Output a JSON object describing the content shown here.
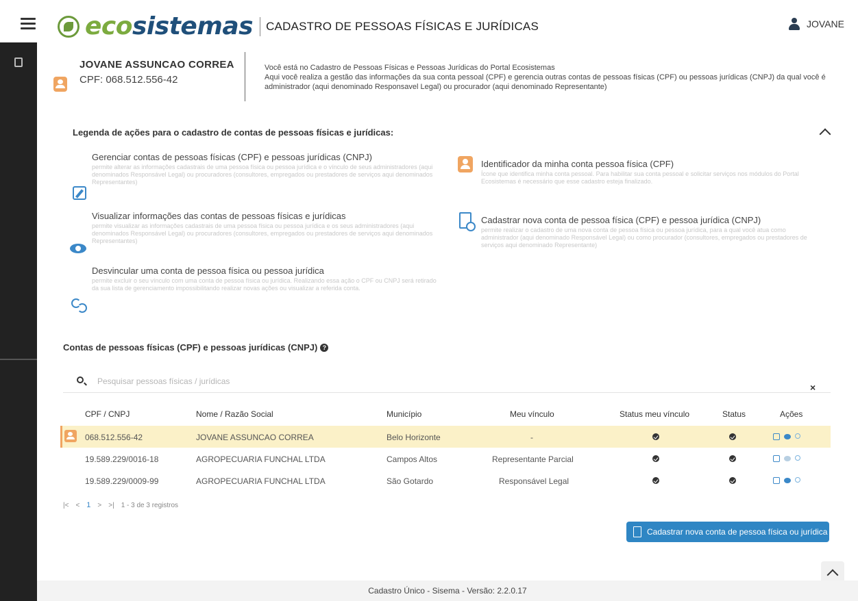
{
  "header": {
    "logo_eco": "eco",
    "logo_sis": "sistemas",
    "title": "CADASTRO DE PESSOAS FÍSICAS E JURÍDICAS",
    "user": "JOVANE"
  },
  "profile": {
    "name": "JOVANE ASSUNCAO CORREA",
    "cpf": "CPF: 068.512.556-42"
  },
  "intro": {
    "line1": "Você está no Cadastro de Pessoas Físicas e Pessoas Jurídicas do Portal Ecosistemas",
    "line2": "Aqui você realiza a gestão das informações da sua conta pessoal (CPF) e gerencia outras contas de pessoas físicas (CPF) ou pessoas jurídicas (CNPJ) da qual você é administrador (aqui denominado Responsavel Legal) ou procurador (aqui denominado Representante)"
  },
  "legend": {
    "title": "Legenda de ações para o cadastro de contas de pessoas físicas e jurídicas:",
    "items": [
      {
        "title": "Gerenciar contas de pessoas físicas (CPF) e pessoas jurídicas (CNPJ)",
        "desc": "permite alterar as informações cadastrais de uma pessoa física ou pessoa jurídica e o vínculo de seus administradores (aqui denominados Responsável Legal) ou procuradores (consultores, empregados ou prestadores de serviços aqui denominados Representantes)",
        "icon": "edit-icon"
      },
      {
        "title": "Visualizar informações das contas de pessoas físicas e jurídicas",
        "desc": "permite visualizar as informações cadastrais de uma pessoa física ou pessoa jurídica e os seus administradores (aqui denominados Responsável Legal) ou procuradores (consultores, empregados ou prestadores de serviços aqui denominados Representantes)",
        "icon": "eye-icon"
      },
      {
        "title": "Desvincular uma conta de pessoa física ou pessoa jurídica",
        "desc": "permite excluir o seu vínculo com uma conta de pessoa física ou jurídica. Realizando essa ação o CPF ou CNPJ será retirado da sua lista de gerenciamento impossibilitando realizar novas ações ou visualizar a referida conta.",
        "icon": "unlink-icon"
      },
      {
        "title": "Identificador da minha conta pessoa física (CPF)",
        "desc": "Ícone que identifica minha conta pessoal. Para habilitar sua conta pessoal e solicitar serviços nos módulos do Portal Ecosistemas é necessário que esse cadastro esteja finalizado.",
        "icon": "person-icon"
      },
      {
        "title": "Cadastrar nova conta de pessoa física (CPF) e pessoa jurídica (CNPJ)",
        "desc": "permite realizar o cadastro de uma nova conta de pessoa física ou pessoa jurídica, para a qual você atua como administrador (aqui denominado Responsável Legal) ou como procurador (consultores, empregados ou prestadores de serviços aqui denominado Representante)",
        "icon": "new-document-icon"
      }
    ]
  },
  "accounts": {
    "title": "Contas de pessoas físicas (CPF) e pessoas jurídicas (CNPJ)",
    "search_placeholder": "Pesquisar pessoas físicas / jurídicas",
    "columns": [
      "CPF / CNPJ",
      "Nome / Razão Social",
      "Município",
      "Meu vínculo",
      "Status meu vínculo",
      "Status",
      "Ações"
    ],
    "rows": [
      {
        "id": "068.512.556-42",
        "name": "JOVANE ASSUNCAO CORREA",
        "city": "Belo Horizonte",
        "link": "-",
        "highlight": true
      },
      {
        "id": "19.589.229/0016-18",
        "name": "AGROPECUARIA FUNCHAL LTDA",
        "city": "Campos Altos",
        "link": "Representante Parcial",
        "highlight": false
      },
      {
        "id": "19.589.229/0009-99",
        "name": "AGROPECUARIA FUNCHAL LTDA",
        "city": "São Gotardo",
        "link": "Responsável Legal",
        "highlight": false
      }
    ],
    "pager": {
      "first": "|<",
      "prev": "<",
      "page": "1",
      "next": ">",
      "last": ">|",
      "summary": "1 - 3 de 3 registros"
    },
    "new_button": "Cadastrar nova conta de pessoa física ou jurídica"
  },
  "footer": {
    "text": "Cadastro Único - Sisema - Versão: 2.2.0.17"
  },
  "colors": {
    "brand_green": "#7cab3f",
    "brand_blue": "#1f4f7a",
    "accent": "#2f86c4",
    "highlight_row": "#fbf1c8",
    "person_badge": "#f0a561",
    "sidebar": "#222222"
  }
}
